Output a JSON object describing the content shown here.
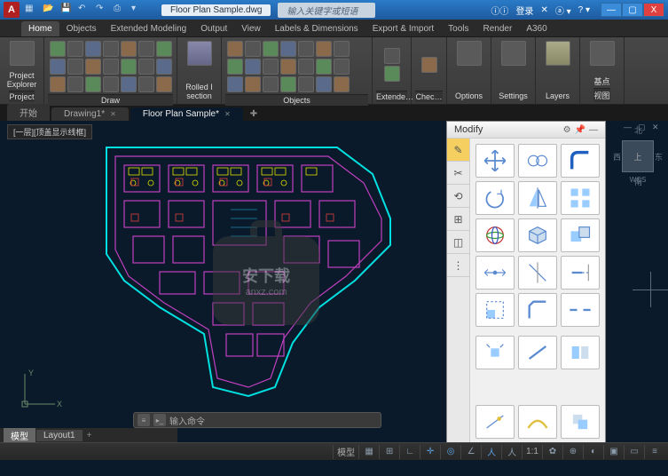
{
  "titlebar": {
    "logo": "A",
    "filename": "Floor Plan Sample.dwg",
    "search_placeholder": "输入关键字或短语",
    "login": "登录",
    "min": "—",
    "max": "▢",
    "close": "X"
  },
  "ribbonTabs": [
    "Home",
    "Objects",
    "Extended Modeling",
    "Output",
    "View",
    "Labels & Dimensions",
    "Export & Import",
    "Tools",
    "Render",
    "A360"
  ],
  "ribbonTabActive": 0,
  "ribbonPanels": {
    "project": {
      "label": "Project",
      "big1": "Project Explorer"
    },
    "draw": "Draw",
    "rolled": "Rolled I section",
    "objects": "Objects",
    "extende": "Extende…",
    "chec": "Chec…",
    "options": "Options",
    "settings": "Settings",
    "layers": "Layers",
    "base": "基点",
    "view": "视图"
  },
  "docTabs": [
    {
      "label": "开始",
      "active": false
    },
    {
      "label": "Drawing1*",
      "active": false
    },
    {
      "label": "Floor Plan Sample*",
      "active": true
    }
  ],
  "breadcrumb": "[一层][顶盖显示线框]",
  "modify": {
    "title": "Modify"
  },
  "watermark": {
    "main": "安下载",
    "sub": "anxz.com"
  },
  "viewcube": {
    "face": "上",
    "n": "北",
    "s": "南",
    "e": "东",
    "w": "西",
    "wcs": "WCS"
  },
  "ucs": {
    "x": "X",
    "y": "Y"
  },
  "commandline": {
    "prompt": "输入命令"
  },
  "layoutTabs": [
    {
      "label": "模型",
      "active": true
    },
    {
      "label": "Layout1",
      "active": false
    }
  ],
  "statusbar": {
    "model": "模型",
    "scale": "1:1",
    "gear": "✿"
  }
}
